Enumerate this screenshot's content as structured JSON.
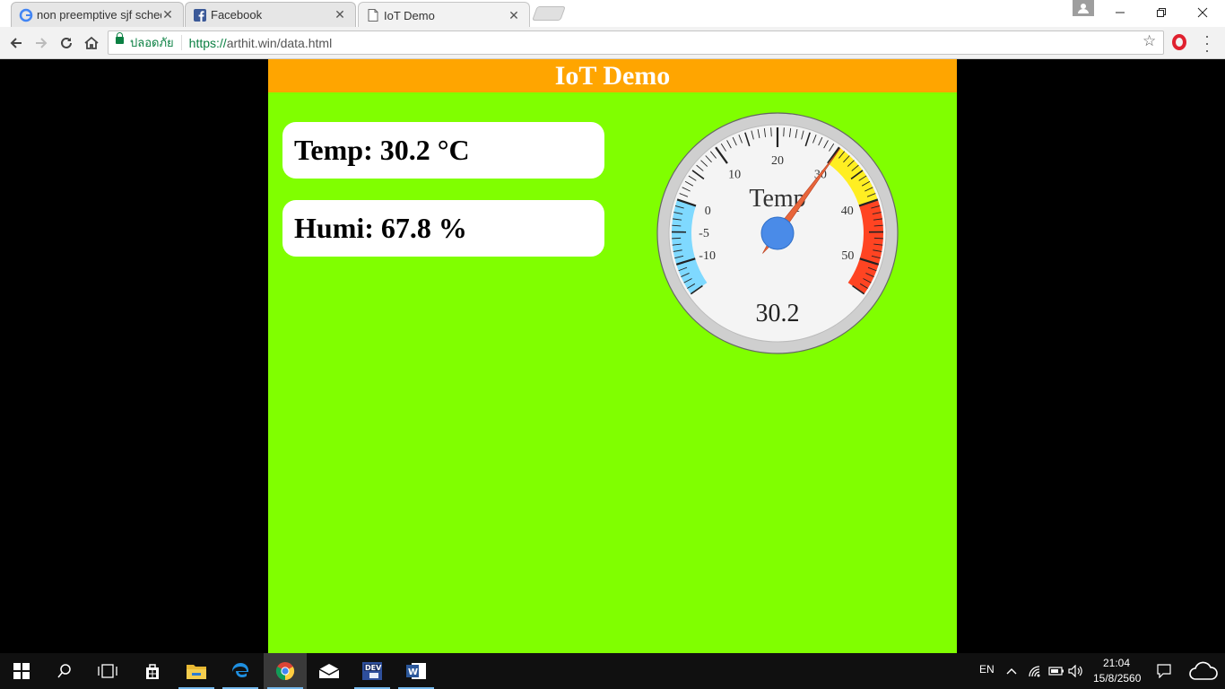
{
  "browser": {
    "tabs": [
      {
        "title": "non preemptive sjf sched",
        "icon": "google-icon",
        "active": false
      },
      {
        "title": "Facebook",
        "icon": "facebook-icon",
        "active": false
      },
      {
        "title": "IoT Demo",
        "icon": "page-icon",
        "active": true
      }
    ],
    "tab_close_glyph": "✕",
    "secure_label": "ปลอดภัย",
    "url_scheme": "https://",
    "url_rest": "arthit.win/data.html"
  },
  "page": {
    "header_title": "IoT Demo",
    "temp_card": "Temp: 30.2 °C",
    "humi_card": "Humi: 67.8 %",
    "header_color": "#ffa500",
    "background_color": "#80ff00"
  },
  "gauge": {
    "label": "Temp",
    "value": 30.2,
    "value_text": "30.2",
    "min": -15,
    "max": 55,
    "major_ticks": [
      "-10",
      "-5",
      "0",
      "10",
      "20",
      "30",
      "40",
      "50"
    ],
    "bands": [
      {
        "from": -15,
        "to": 0,
        "color": "#7fd9ff"
      },
      {
        "from": 30,
        "to": 40,
        "color": "#ffee22"
      },
      {
        "from": 40,
        "to": 55,
        "color": "#ff4422"
      }
    ],
    "needle_color": "#e8653a",
    "hub_color": "#4a8be8"
  },
  "taskbar": {
    "lang": "EN",
    "time": "21:04",
    "date": "15/8/2560"
  }
}
